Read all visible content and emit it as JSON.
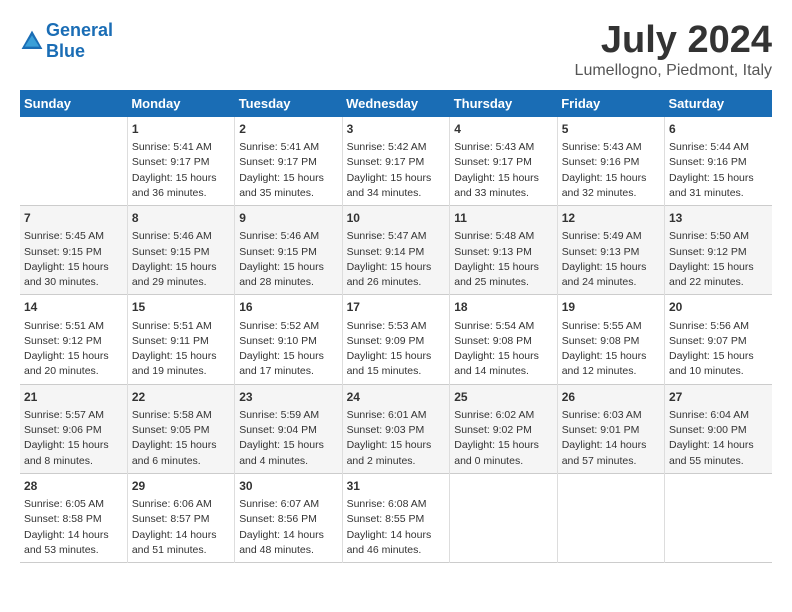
{
  "header": {
    "logo_line1": "General",
    "logo_line2": "Blue",
    "month_year": "July 2024",
    "location": "Lumellogno, Piedmont, Italy"
  },
  "days_of_week": [
    "Sunday",
    "Monday",
    "Tuesday",
    "Wednesday",
    "Thursday",
    "Friday",
    "Saturday"
  ],
  "weeks": [
    [
      {
        "day": "",
        "content": ""
      },
      {
        "day": "1",
        "content": "Sunrise: 5:41 AM\nSunset: 9:17 PM\nDaylight: 15 hours\nand 36 minutes."
      },
      {
        "day": "2",
        "content": "Sunrise: 5:41 AM\nSunset: 9:17 PM\nDaylight: 15 hours\nand 35 minutes."
      },
      {
        "day": "3",
        "content": "Sunrise: 5:42 AM\nSunset: 9:17 PM\nDaylight: 15 hours\nand 34 minutes."
      },
      {
        "day": "4",
        "content": "Sunrise: 5:43 AM\nSunset: 9:17 PM\nDaylight: 15 hours\nand 33 minutes."
      },
      {
        "day": "5",
        "content": "Sunrise: 5:43 AM\nSunset: 9:16 PM\nDaylight: 15 hours\nand 32 minutes."
      },
      {
        "day": "6",
        "content": "Sunrise: 5:44 AM\nSunset: 9:16 PM\nDaylight: 15 hours\nand 31 minutes."
      }
    ],
    [
      {
        "day": "7",
        "content": "Sunrise: 5:45 AM\nSunset: 9:15 PM\nDaylight: 15 hours\nand 30 minutes."
      },
      {
        "day": "8",
        "content": "Sunrise: 5:46 AM\nSunset: 9:15 PM\nDaylight: 15 hours\nand 29 minutes."
      },
      {
        "day": "9",
        "content": "Sunrise: 5:46 AM\nSunset: 9:15 PM\nDaylight: 15 hours\nand 28 minutes."
      },
      {
        "day": "10",
        "content": "Sunrise: 5:47 AM\nSunset: 9:14 PM\nDaylight: 15 hours\nand 26 minutes."
      },
      {
        "day": "11",
        "content": "Sunrise: 5:48 AM\nSunset: 9:13 PM\nDaylight: 15 hours\nand 25 minutes."
      },
      {
        "day": "12",
        "content": "Sunrise: 5:49 AM\nSunset: 9:13 PM\nDaylight: 15 hours\nand 24 minutes."
      },
      {
        "day": "13",
        "content": "Sunrise: 5:50 AM\nSunset: 9:12 PM\nDaylight: 15 hours\nand 22 minutes."
      }
    ],
    [
      {
        "day": "14",
        "content": "Sunrise: 5:51 AM\nSunset: 9:12 PM\nDaylight: 15 hours\nand 20 minutes."
      },
      {
        "day": "15",
        "content": "Sunrise: 5:51 AM\nSunset: 9:11 PM\nDaylight: 15 hours\nand 19 minutes."
      },
      {
        "day": "16",
        "content": "Sunrise: 5:52 AM\nSunset: 9:10 PM\nDaylight: 15 hours\nand 17 minutes."
      },
      {
        "day": "17",
        "content": "Sunrise: 5:53 AM\nSunset: 9:09 PM\nDaylight: 15 hours\nand 15 minutes."
      },
      {
        "day": "18",
        "content": "Sunrise: 5:54 AM\nSunset: 9:08 PM\nDaylight: 15 hours\nand 14 minutes."
      },
      {
        "day": "19",
        "content": "Sunrise: 5:55 AM\nSunset: 9:08 PM\nDaylight: 15 hours\nand 12 minutes."
      },
      {
        "day": "20",
        "content": "Sunrise: 5:56 AM\nSunset: 9:07 PM\nDaylight: 15 hours\nand 10 minutes."
      }
    ],
    [
      {
        "day": "21",
        "content": "Sunrise: 5:57 AM\nSunset: 9:06 PM\nDaylight: 15 hours\nand 8 minutes."
      },
      {
        "day": "22",
        "content": "Sunrise: 5:58 AM\nSunset: 9:05 PM\nDaylight: 15 hours\nand 6 minutes."
      },
      {
        "day": "23",
        "content": "Sunrise: 5:59 AM\nSunset: 9:04 PM\nDaylight: 15 hours\nand 4 minutes."
      },
      {
        "day": "24",
        "content": "Sunrise: 6:01 AM\nSunset: 9:03 PM\nDaylight: 15 hours\nand 2 minutes."
      },
      {
        "day": "25",
        "content": "Sunrise: 6:02 AM\nSunset: 9:02 PM\nDaylight: 15 hours\nand 0 minutes."
      },
      {
        "day": "26",
        "content": "Sunrise: 6:03 AM\nSunset: 9:01 PM\nDaylight: 14 hours\nand 57 minutes."
      },
      {
        "day": "27",
        "content": "Sunrise: 6:04 AM\nSunset: 9:00 PM\nDaylight: 14 hours\nand 55 minutes."
      }
    ],
    [
      {
        "day": "28",
        "content": "Sunrise: 6:05 AM\nSunset: 8:58 PM\nDaylight: 14 hours\nand 53 minutes."
      },
      {
        "day": "29",
        "content": "Sunrise: 6:06 AM\nSunset: 8:57 PM\nDaylight: 14 hours\nand 51 minutes."
      },
      {
        "day": "30",
        "content": "Sunrise: 6:07 AM\nSunset: 8:56 PM\nDaylight: 14 hours\nand 48 minutes."
      },
      {
        "day": "31",
        "content": "Sunrise: 6:08 AM\nSunset: 8:55 PM\nDaylight: 14 hours\nand 46 minutes."
      },
      {
        "day": "",
        "content": ""
      },
      {
        "day": "",
        "content": ""
      },
      {
        "day": "",
        "content": ""
      }
    ]
  ]
}
